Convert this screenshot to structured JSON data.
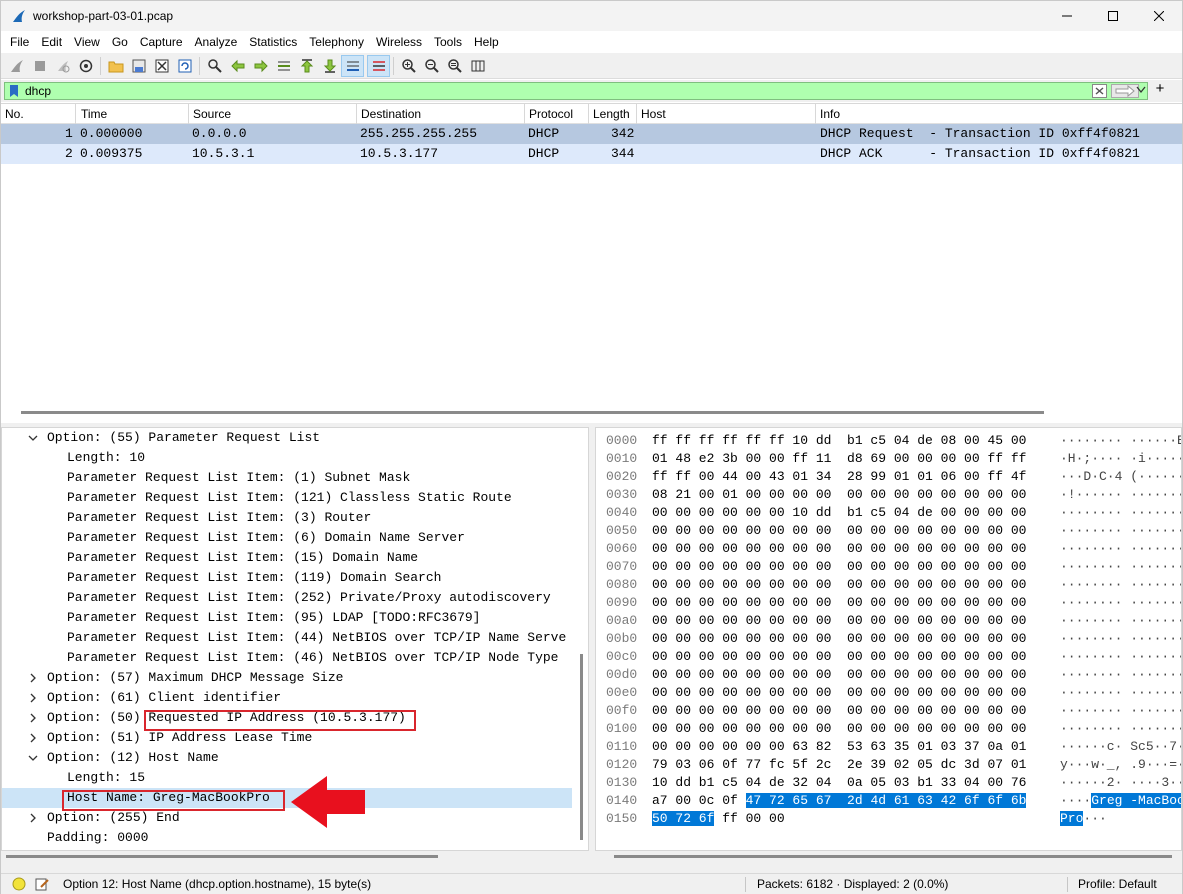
{
  "window": {
    "title": "workshop-part-03-01.pcap"
  },
  "menu": [
    "File",
    "Edit",
    "View",
    "Go",
    "Capture",
    "Analyze",
    "Statistics",
    "Telephony",
    "Wireless",
    "Tools",
    "Help"
  ],
  "toolbar_icons": [
    "shark-fin-start-icon",
    "stop-icon",
    "restart-icon",
    "options-gear-icon",
    "open-folder-icon",
    "save-file-icon",
    "close-file-icon",
    "reload-icon",
    "find-icon",
    "go-back-icon",
    "go-forward-icon",
    "go-to-packet-icon",
    "first-packet-icon",
    "last-packet-icon",
    "autoscroll-icon",
    "colorize-icon",
    "zoom-in-icon",
    "zoom-out-icon",
    "zoom-normal-icon",
    "resize-columns-icon"
  ],
  "filter": {
    "value": "dhcp",
    "plus": "+"
  },
  "columns": [
    "No.",
    "Time",
    "Source",
    "Destination",
    "Protocol",
    "Length",
    "Host",
    "Info"
  ],
  "packets": [
    {
      "no": "1",
      "time": "0.000000",
      "source": "0.0.0.0",
      "destination": "255.255.255.255",
      "protocol": "DHCP",
      "length": "342",
      "host": "",
      "info": "DHCP Request  - Transaction ID 0xff4f0821"
    },
    {
      "no": "2",
      "time": "0.009375",
      "source": "10.5.3.1",
      "destination": "10.5.3.177",
      "protocol": "DHCP",
      "length": "344",
      "host": "",
      "info": "DHCP ACK      - Transaction ID 0xff4f0821"
    }
  ],
  "details": [
    {
      "text": "Option: (55) Parameter Request List",
      "indent": 0,
      "arrow": "down"
    },
    {
      "text": "Length: 10",
      "indent": 1,
      "arrow": ""
    },
    {
      "text": "Parameter Request List Item: (1) Subnet Mask",
      "indent": 1,
      "arrow": ""
    },
    {
      "text": "Parameter Request List Item: (121) Classless Static Route",
      "indent": 1,
      "arrow": ""
    },
    {
      "text": "Parameter Request List Item: (3) Router",
      "indent": 1,
      "arrow": ""
    },
    {
      "text": "Parameter Request List Item: (6) Domain Name Server",
      "indent": 1,
      "arrow": ""
    },
    {
      "text": "Parameter Request List Item: (15) Domain Name",
      "indent": 1,
      "arrow": ""
    },
    {
      "text": "Parameter Request List Item: (119) Domain Search",
      "indent": 1,
      "arrow": ""
    },
    {
      "text": "Parameter Request List Item: (252) Private/Proxy autodiscovery",
      "indent": 1,
      "arrow": ""
    },
    {
      "text": "Parameter Request List Item: (95) LDAP [TODO:RFC3679]",
      "indent": 1,
      "arrow": ""
    },
    {
      "text": "Parameter Request List Item: (44) NetBIOS over TCP/IP Name Serve",
      "indent": 1,
      "arrow": ""
    },
    {
      "text": "Parameter Request List Item: (46) NetBIOS over TCP/IP Node Type",
      "indent": 1,
      "arrow": ""
    },
    {
      "text": "Option: (57) Maximum DHCP Message Size",
      "indent": 0,
      "arrow": "right"
    },
    {
      "text": "Option: (61) Client identifier",
      "indent": 0,
      "arrow": "right"
    },
    {
      "text": "Option: (50) Requested IP Address (10.5.3.177)",
      "indent": 0,
      "arrow": "right"
    },
    {
      "text": "Option: (51) IP Address Lease Time",
      "indent": 0,
      "arrow": "right"
    },
    {
      "text": "Option: (12) Host Name",
      "indent": 0,
      "arrow": "down"
    },
    {
      "text": "Length: 15",
      "indent": 1,
      "arrow": ""
    },
    {
      "text": "Host Name: Greg-MacBookPro",
      "indent": 1,
      "arrow": "",
      "selected": true
    },
    {
      "text": "Option: (255) End",
      "indent": 0,
      "arrow": "right"
    },
    {
      "text": "Padding: 0000",
      "indent": 0,
      "arrow": ""
    }
  ],
  "hex": [
    {
      "o": "0000",
      "b": "ff ff ff ff ff ff 10 dd  b1 c5 04 de 08 00 45 00",
      "a": "········ ······E·"
    },
    {
      "o": "0010",
      "b": "01 48 e2 3b 00 00 ff 11  d8 69 00 00 00 00 ff ff",
      "a": "·H·;···· ·i······"
    },
    {
      "o": "0020",
      "b": "ff ff 00 44 00 43 01 34  28 99 01 01 06 00 ff 4f",
      "a": "···D·C·4 (······O"
    },
    {
      "o": "0030",
      "b": "08 21 00 01 00 00 00 00  00 00 00 00 00 00 00 00",
      "a": "·!······ ········"
    },
    {
      "o": "0040",
      "b": "00 00 00 00 00 00 10 dd  b1 c5 04 de 00 00 00 00",
      "a": "········ ········"
    },
    {
      "o": "0050",
      "b": "00 00 00 00 00 00 00 00  00 00 00 00 00 00 00 00",
      "a": "········ ········"
    },
    {
      "o": "0060",
      "b": "00 00 00 00 00 00 00 00  00 00 00 00 00 00 00 00",
      "a": "········ ········"
    },
    {
      "o": "0070",
      "b": "00 00 00 00 00 00 00 00  00 00 00 00 00 00 00 00",
      "a": "········ ········"
    },
    {
      "o": "0080",
      "b": "00 00 00 00 00 00 00 00  00 00 00 00 00 00 00 00",
      "a": "········ ········"
    },
    {
      "o": "0090",
      "b": "00 00 00 00 00 00 00 00  00 00 00 00 00 00 00 00",
      "a": "········ ········"
    },
    {
      "o": "00a0",
      "b": "00 00 00 00 00 00 00 00  00 00 00 00 00 00 00 00",
      "a": "········ ········"
    },
    {
      "o": "00b0",
      "b": "00 00 00 00 00 00 00 00  00 00 00 00 00 00 00 00",
      "a": "········ ········"
    },
    {
      "o": "00c0",
      "b": "00 00 00 00 00 00 00 00  00 00 00 00 00 00 00 00",
      "a": "········ ········"
    },
    {
      "o": "00d0",
      "b": "00 00 00 00 00 00 00 00  00 00 00 00 00 00 00 00",
      "a": "········ ········"
    },
    {
      "o": "00e0",
      "b": "00 00 00 00 00 00 00 00  00 00 00 00 00 00 00 00",
      "a": "········ ········"
    },
    {
      "o": "00f0",
      "b": "00 00 00 00 00 00 00 00  00 00 00 00 00 00 00 00",
      "a": "········ ········"
    },
    {
      "o": "0100",
      "b": "00 00 00 00 00 00 00 00  00 00 00 00 00 00 00 00",
      "a": "········ ········"
    },
    {
      "o": "0110",
      "b": "00 00 00 00 00 00 63 82  53 63 35 01 03 37 0a 01",
      "a": "······c· Sc5··7··"
    },
    {
      "o": "0120",
      "b": "79 03 06 0f 77 fc 5f 2c  2e 39 02 05 dc 3d 07 01",
      "a": "y···w·_, .9···=··"
    },
    {
      "o": "0130",
      "b": "10 dd b1 c5 04 de 32 04  0a 05 03 b1 33 04 00 76",
      "a": "······2· ····3··v"
    },
    {
      "o": "0140",
      "b": "a7 00 0c 0f ",
      "bs": "47 72 65 67  2d 4d 61 63 42 6f 6f 6b",
      "a": "····",
      "as": "Greg -MacBook"
    },
    {
      "o": "0150",
      "b": "",
      "bs": "50 72 6f",
      "b2": " ff 00 00",
      "a": "",
      "as": "Pro",
      "a2": "···"
    }
  ],
  "status": {
    "field": "Option 12: Host Name (dhcp.option.hostname), 15 byte(s)",
    "packets": "Packets: 6182 · Displayed: 2 (0.0%)",
    "profile": "Profile: Default"
  },
  "colors": {
    "filter_bg": "#afffaf",
    "selected_row": "#b6c8e0",
    "hex_select": "#0078d7",
    "annotation_red": "#d9262d"
  }
}
